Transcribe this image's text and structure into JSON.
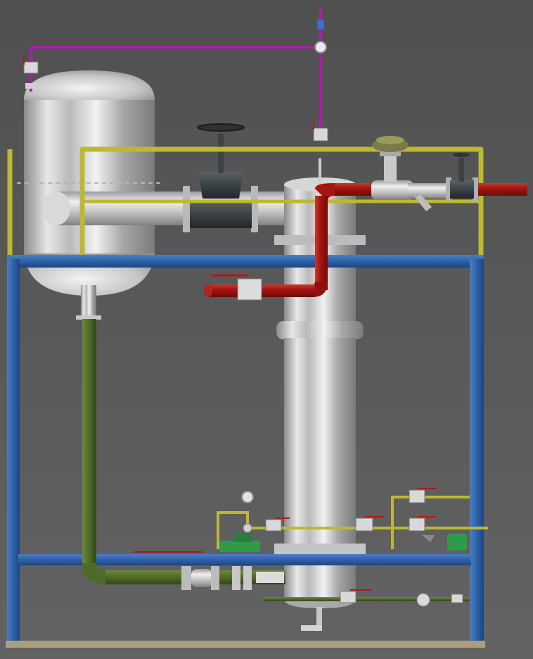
{
  "scene": {
    "title": "",
    "colors": {
      "background": "#5a5a5a",
      "frame": "#2e62a8",
      "vent_line": "#a81fa8",
      "steam_line": "#a61410",
      "drain_line": "#4f6b27",
      "handrail": "#bdb833",
      "vessel_metal": "#c8c8c8",
      "valve_body": "#3c4246",
      "base_plate": "#a89f82",
      "trap_green": "#2e9a4a",
      "handle_red": "#b31818"
    },
    "components": [
      "horizontal-vessel",
      "vertical-column",
      "support-frame",
      "vent-line",
      "steam-line",
      "drain-line",
      "control-valve",
      "gate-valve",
      "strainer",
      "steam-traps",
      "ball-valves"
    ]
  }
}
